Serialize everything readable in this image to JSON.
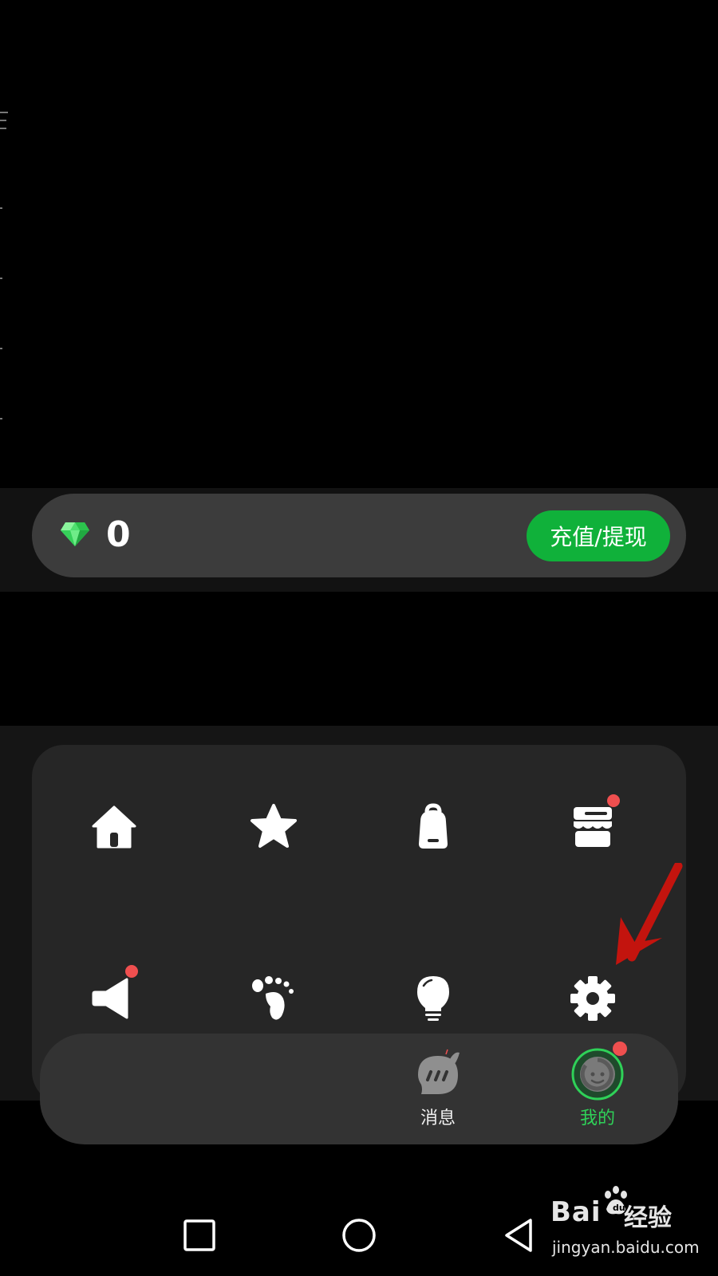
{
  "wallet": {
    "balance": "0",
    "recharge_label": "充值/提现",
    "diamond_icon": "diamond-icon",
    "accent": "#10b13a"
  },
  "menu": {
    "items": [
      {
        "icon": "home-icon",
        "badge": false
      },
      {
        "icon": "star-icon",
        "badge": false
      },
      {
        "icon": "backpack-icon",
        "badge": false
      },
      {
        "icon": "store-icon",
        "badge": true
      },
      {
        "icon": "megaphone-icon",
        "badge": true
      },
      {
        "icon": "footprint-icon",
        "badge": false
      },
      {
        "icon": "lightbulb-icon",
        "badge": false
      },
      {
        "icon": "gear-icon",
        "badge": false
      }
    ],
    "badge_color": "#ef4f4f"
  },
  "tabbar": {
    "tabs": [
      {
        "label": "消息",
        "icon": "chat-bubble-icon",
        "active": false
      },
      {
        "label": "我的",
        "icon": "profile-icon",
        "active": true,
        "badge": true
      }
    ],
    "active_color": "#2fd158"
  },
  "system_nav": {
    "buttons": [
      "recents-square-icon",
      "home-circle-icon",
      "back-triangle-icon"
    ]
  },
  "watermark": {
    "brand": "Bai",
    "brand_suffix": "经验",
    "url": "jingyan.baidu.com"
  }
}
